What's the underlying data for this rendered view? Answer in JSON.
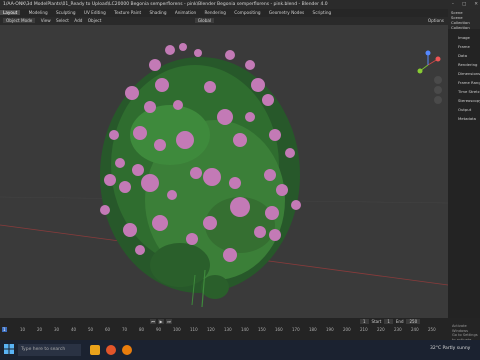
{
  "window": {
    "title": "1/AA-ONK\\3d ModelPlants\\01_Ready to Upload\\LC20000 Begonia semperflorens - pink\\Blender Begonia semperflorens - pink.blend - Blender 4.0",
    "controls": [
      "–",
      "□",
      "✕"
    ]
  },
  "menu": {
    "items": [
      "Layout",
      "Modeling",
      "Sculpting",
      "UV Editing",
      "Texture Paint",
      "Shading",
      "Animation",
      "Rendering",
      "Compositing",
      "Geometry Nodes",
      "Scripting"
    ],
    "active": "Layout"
  },
  "viewport_header": {
    "mode": "Object Mode",
    "view": "View",
    "select": "Select",
    "add": "Add",
    "object": "Object",
    "global": "Global",
    "options": "Options"
  },
  "outliner": {
    "title": "Scene",
    "items": [
      "Scene Collection",
      "Collection"
    ]
  },
  "properties": {
    "labels": [
      "Image",
      "Frame",
      "Data",
      "Rendering",
      "Dimensions",
      "Frame Range",
      "Time Stretching",
      "Stereoscopy",
      "Output",
      "Metadata"
    ]
  },
  "timeline": {
    "current_frame": "1",
    "ticks": [
      "10",
      "20",
      "30",
      "40",
      "50",
      "60",
      "70",
      "80",
      "90",
      "100",
      "110",
      "120",
      "130",
      "140",
      "150",
      "160",
      "170",
      "180",
      "190",
      "200",
      "210",
      "220",
      "230",
      "240",
      "250"
    ],
    "start": "1",
    "end": "250",
    "start_label": "Start",
    "end_label": "End"
  },
  "watermark": {
    "line1": "Activate Windows",
    "line2": "Go to Settings to activate Windows."
  },
  "taskbar": {
    "search": "Type here to search",
    "weather": "32°C Partly sunny"
  },
  "colors": {
    "viewport_bg": "#3a3a3a",
    "flower": "#c37ab6",
    "leaf": "#2f6d2f"
  }
}
